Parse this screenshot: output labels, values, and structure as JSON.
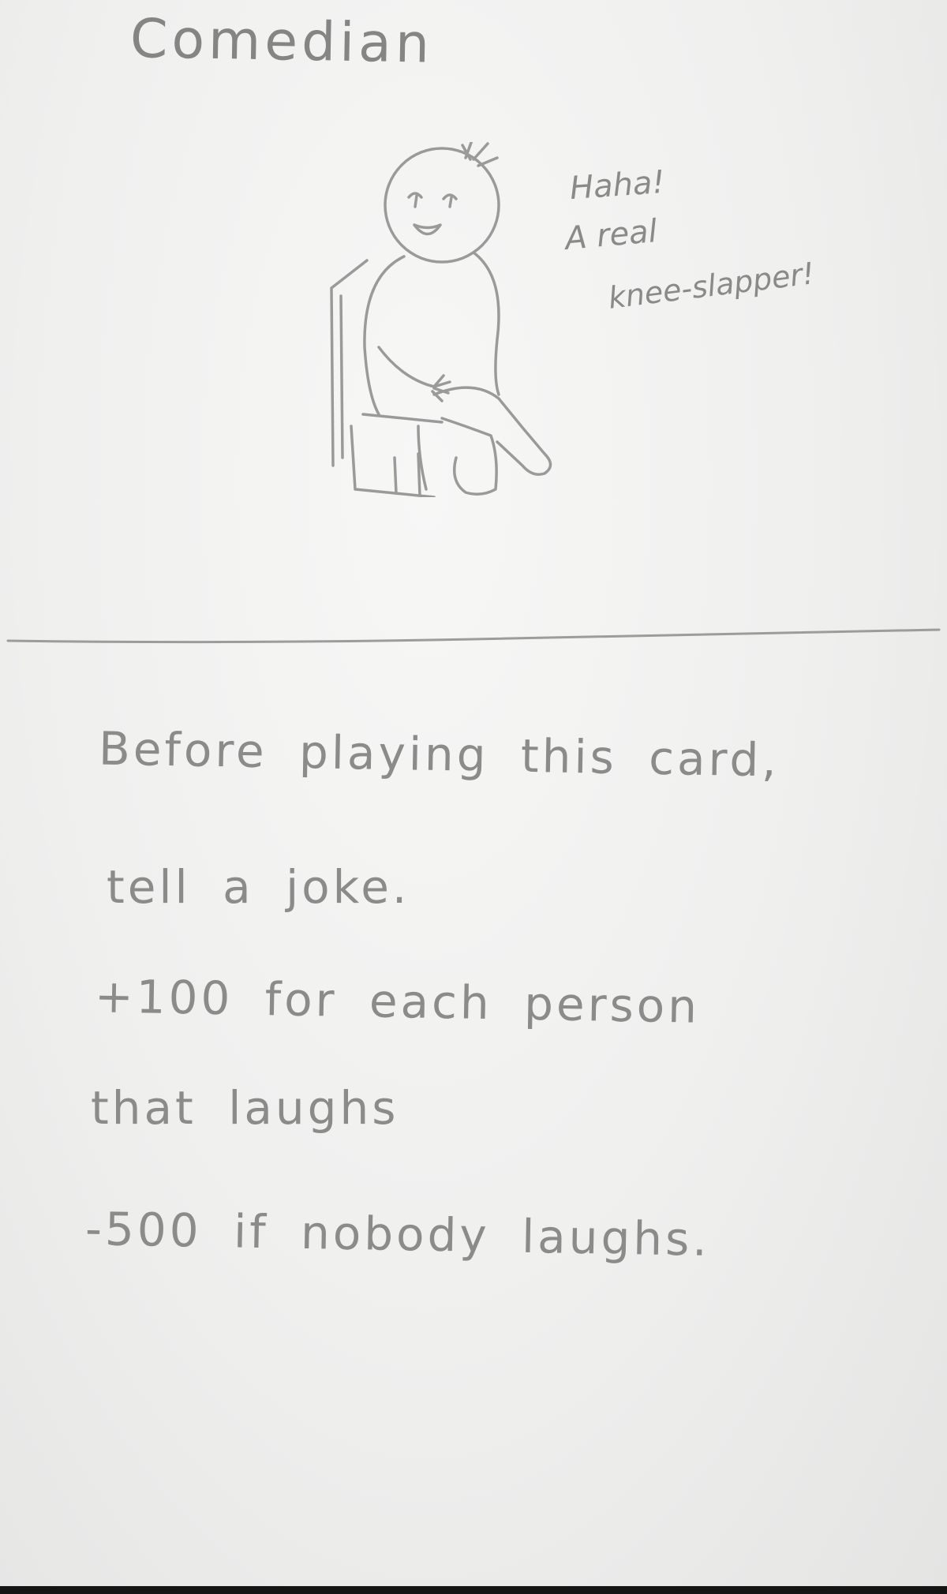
{
  "card": {
    "title": "Comedian",
    "speech_bubble": {
      "lines": [
        "Haha!",
        "A real",
        "knee-slapper!"
      ]
    },
    "rules": [
      "Before playing this card,",
      "tell a joke.",
      "+100 for each person",
      "that laughs",
      "-500 if nobody laughs."
    ]
  },
  "colors": {
    "paper": "#efefee",
    "pencil": "#7d7d7b"
  },
  "icons": {
    "illustration": "laughing-person-sitting-in-chair-icon"
  }
}
